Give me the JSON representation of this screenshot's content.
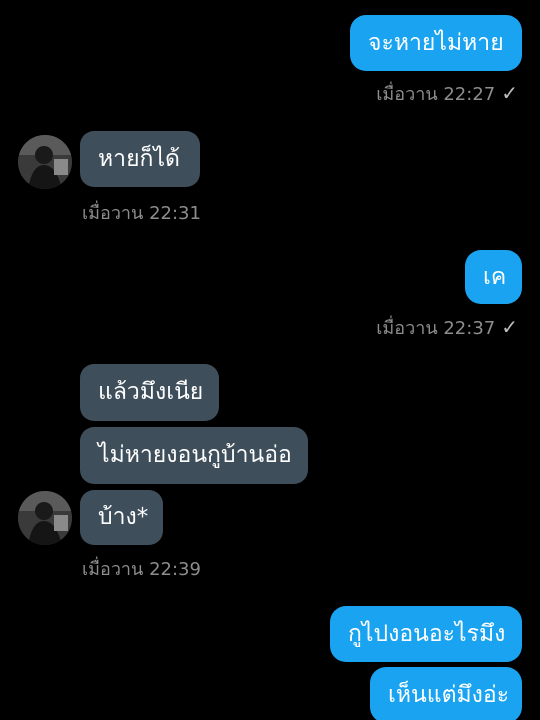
{
  "messages": [
    {
      "side": "out",
      "text": "จะหายไม่หาย",
      "meta": "เมื่อวาน 22:27"
    },
    {
      "side": "in",
      "text": "หายก็ได้",
      "meta": "เมื่อวาน 22:31"
    },
    {
      "side": "out",
      "text": "เค",
      "meta": "เมื่อวาน 22:37"
    },
    {
      "side": "in",
      "text": "แล้วมึงเนีย"
    },
    {
      "side": "in",
      "text": "ไม่หายงอนกูบ้านอ่อ"
    },
    {
      "side": "in",
      "text": "บ้าง*",
      "meta": "เมื่อวาน 22:39"
    },
    {
      "side": "out",
      "text": "กูไปงอนอะไรมึง"
    },
    {
      "side": "out",
      "text": "เห็นแต่มึงอ่ะ"
    }
  ],
  "read_mark": "✓",
  "colors": {
    "outgoing": "#1aa3f0",
    "incoming": "#3e4e5a",
    "background": "#000000"
  },
  "icons": {
    "read": "check-icon",
    "avatar": "contact-avatar"
  }
}
